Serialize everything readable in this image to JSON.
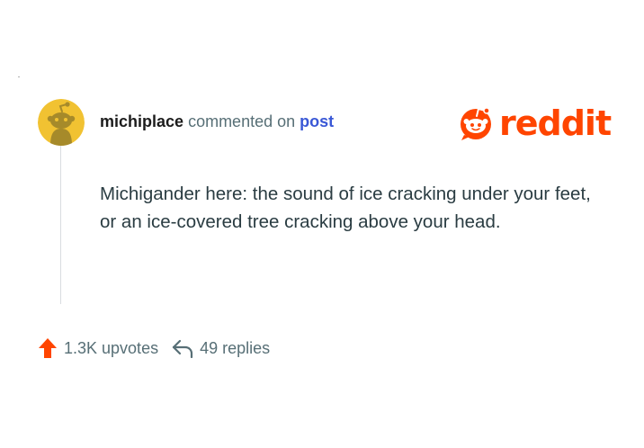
{
  "comment": {
    "username": "michiplace",
    "action_text": "commented on",
    "post_link": "post",
    "body": "Michigander here: the sound of ice cracking under your feet, or an ice-covered tree cracking above your head."
  },
  "brand": {
    "wordmark": "reddit",
    "logo_icon": "reddit-snoo-icon",
    "color": "#ff4500"
  },
  "footer": {
    "upvotes": "1.3K upvotes",
    "replies": "49 replies",
    "upvote_icon": "upvote-arrow-icon",
    "reply_icon": "reply-arrow-icon",
    "upvote_color": "#ff4500"
  },
  "colors": {
    "username": "#1c1c1c",
    "meta": "#576f76",
    "link": "#3a58d6",
    "body_text": "#2a3c42",
    "avatar_bg": "#f1c232",
    "avatar_snoo": "#a68a2a"
  }
}
